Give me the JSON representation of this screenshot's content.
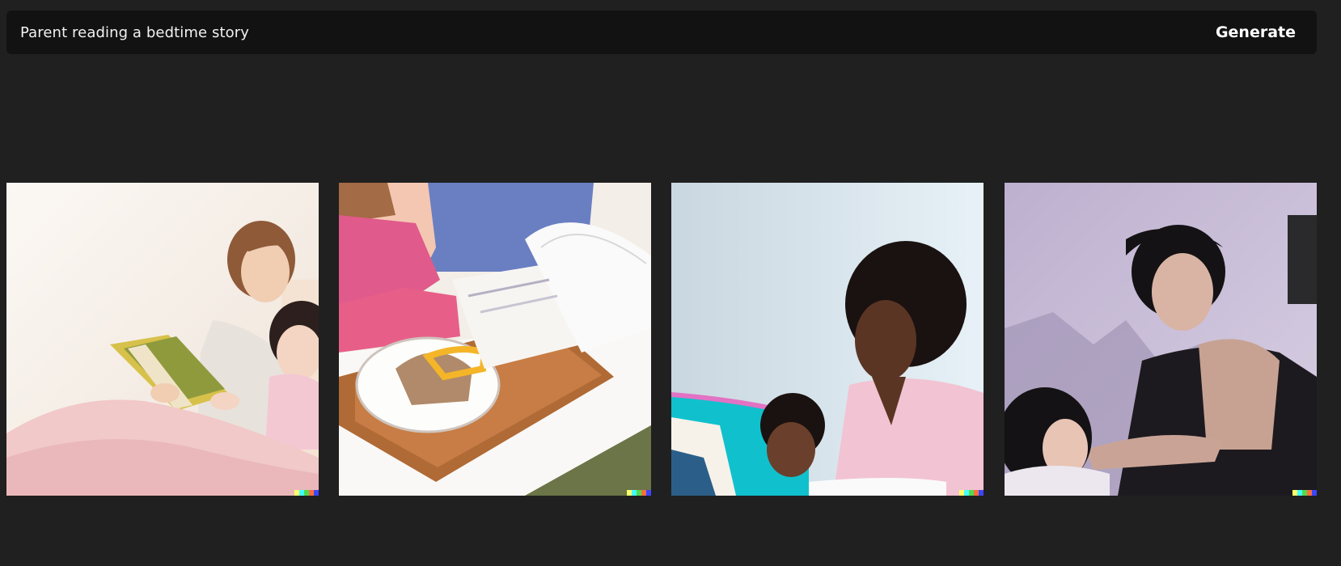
{
  "prompt": {
    "text": "Parent reading a bedtime story",
    "generate_label": "Generate"
  },
  "images": [
    {
      "name": "result-image-1",
      "subject": "mother-and-daughter-reading-in-bed"
    },
    {
      "name": "result-image-2",
      "subject": "child-with-book-and-tray"
    },
    {
      "name": "result-image-3",
      "subject": "mother-reading-to-daughter"
    },
    {
      "name": "result-image-4",
      "subject": "man-and-child-reading"
    }
  ],
  "watermark_colors": [
    "#ffff66",
    "#42ffff",
    "#51da4c",
    "#ff6e3c",
    "#3c46ff"
  ],
  "colors": {
    "background": "#202020",
    "prompt_bar": "#121212",
    "text": "#ffffff"
  }
}
